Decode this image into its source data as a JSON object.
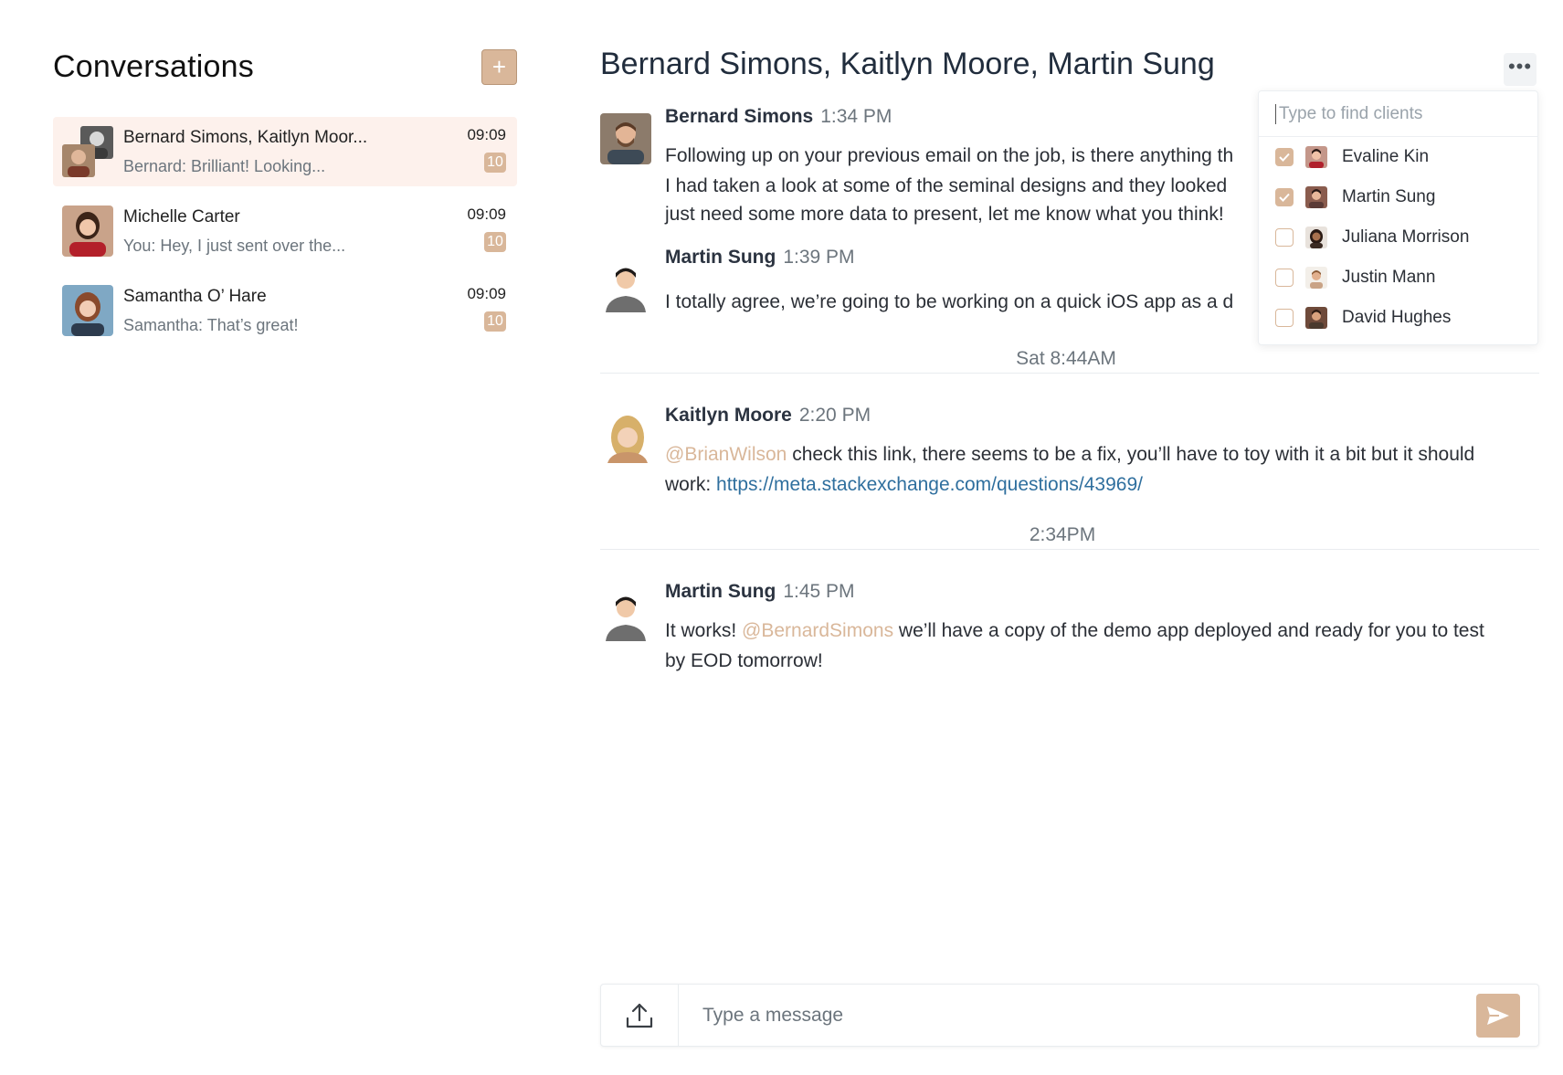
{
  "sidebar": {
    "title": "Conversations",
    "add_label": "+",
    "conversations": [
      {
        "name": "Bernard Simons, Kaitlyn Moor...",
        "preview": "Bernard: Brilliant! Looking...",
        "time": "09:09",
        "badge": "10",
        "active": true
      },
      {
        "name": "Michelle Carter",
        "preview": "You: Hey, I just sent over the...",
        "time": "09:09",
        "badge": "10",
        "active": false
      },
      {
        "name": "Samantha O’ Hare",
        "preview": "Samantha: That’s great!",
        "time": "09:09",
        "badge": "10",
        "active": false
      }
    ]
  },
  "chat": {
    "title": "Bernard Simons, Kaitlyn Moore, Martin Sung",
    "more_label": "•••",
    "messages": [
      {
        "author": "Bernard Simons",
        "time": "1:34 PM",
        "lines": [
          "Following up on your previous email on the job, is there anything th",
          "I had taken a look at some of the seminal designs and they looked",
          "just need some more data to present, let me know what you think!"
        ]
      },
      {
        "author": "Martin Sung",
        "time": "1:39 PM",
        "lines": [
          "I totally agree, we’re going to be working on a quick iOS app as a d"
        ]
      },
      {
        "author": "Kaitlyn Moore",
        "time": "2:20 PM",
        "mention": "@BrianWilson",
        "text_after_mention": " check this link, there seems to be a fix, you’ll have to toy with it a bit but it should",
        "line2_prefix": "work: ",
        "link": "https://meta.stackexchange.com/questions/43969/"
      },
      {
        "author": "Martin Sung",
        "time": "1:45 PM",
        "prefix": "It works! ",
        "mention": "@BernardSimons",
        "text_after_mention": " we’ll have a copy of the demo app deployed and ready for you to test",
        "line2": "by EOD tomorrow!"
      }
    ],
    "dividers": [
      "Sat 8:44AM",
      "2:34PM"
    ]
  },
  "composer": {
    "placeholder": "Type a message"
  },
  "dropdown": {
    "placeholder": "Type to find clients",
    "clients": [
      {
        "name": "Evaline Kin",
        "checked": true
      },
      {
        "name": "Martin Sung",
        "checked": true
      },
      {
        "name": "Juliana Morrison",
        "checked": false
      },
      {
        "name": "Justin Mann",
        "checked": false
      },
      {
        "name": "David Hughes",
        "checked": false
      }
    ]
  },
  "colors": {
    "accent": "#d9b79a",
    "active_bg": "#fdf1ec",
    "link": "#2f6f9e"
  }
}
